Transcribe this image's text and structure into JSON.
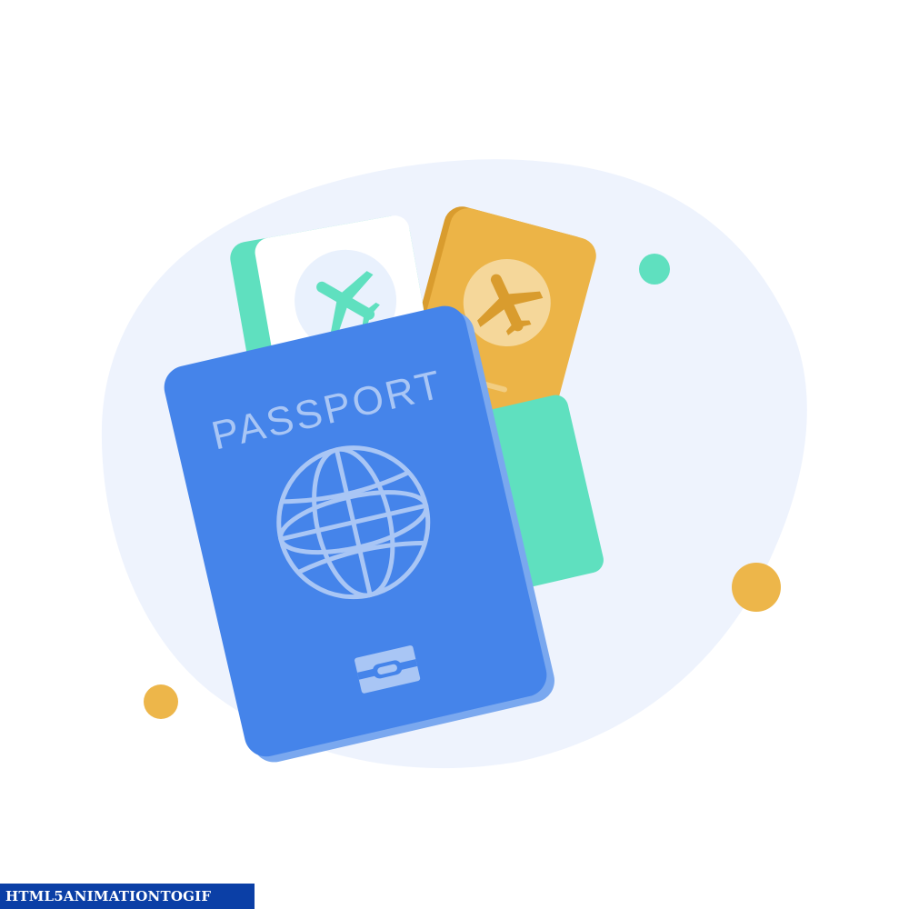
{
  "illustration": {
    "passport_label": "PASSPORT",
    "icons": {
      "globe": "globe-icon",
      "airplane": "airplane-icon",
      "chip": "biometric-chip-icon"
    },
    "colors": {
      "blob": "#eef3fd",
      "passport_blue": "#4584ea",
      "passport_text": "#a9c6f5",
      "ticket_green": "#5fe0bf",
      "ticket_white": "#ffffff",
      "ticket_gold": "#ecb447",
      "ticket_gold_dark": "#d99c2e",
      "dot_green": "#5fe0bf",
      "dot_gold": "#edb64a"
    }
  },
  "watermark": {
    "text": "HTML5ANIMATIONTOGIF"
  }
}
